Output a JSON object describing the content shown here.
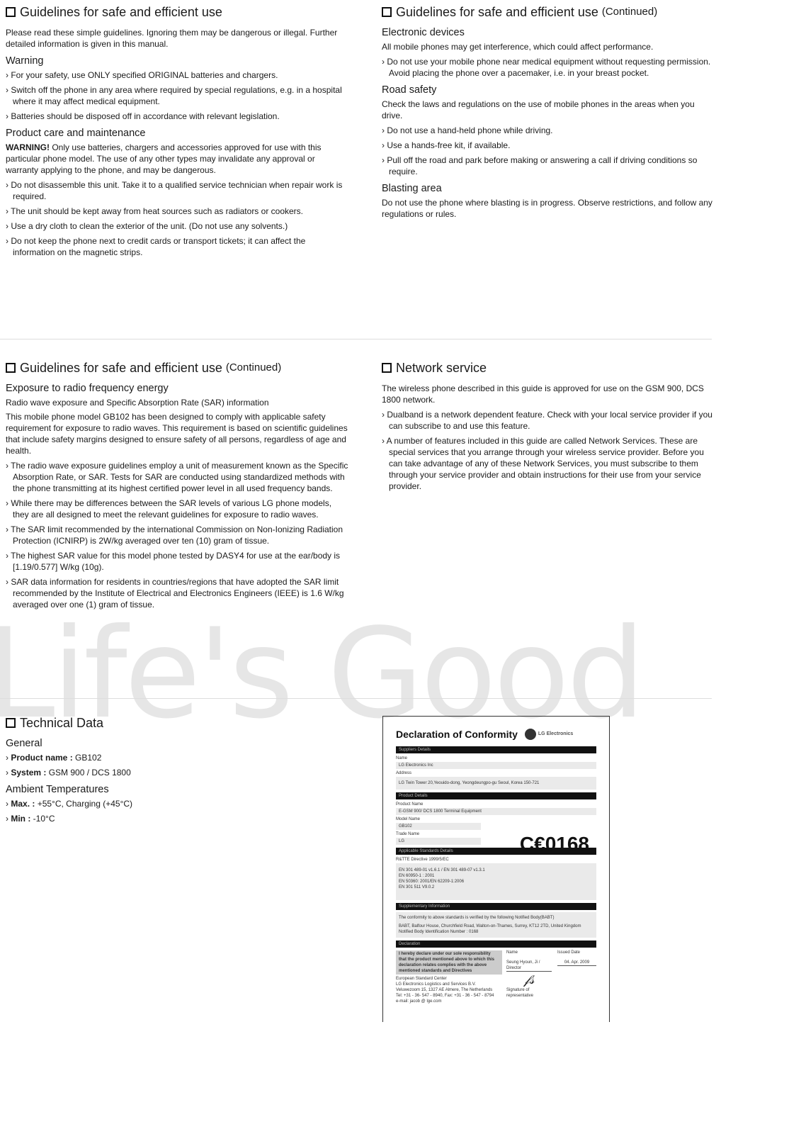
{
  "watermark": "Life's Good",
  "tl": {
    "title": "Guidelines for safe and efficient use",
    "intro": "Please read these simple guidelines. Ignoring them may be dangerous or illegal. Further detailed information is given in this manual.",
    "warning": {
      "heading": "Warning",
      "items": [
        "For your safety, use ONLY specified ORIGINAL batteries and chargers.",
        "Switch off the phone in any area where required by special regulations, e.g. in a hospital where it may affect medical equipment.",
        "Batteries should be disposed off in accordance with relevant legislation."
      ]
    },
    "care": {
      "heading": "Product care and maintenance",
      "warning_label": "WARNING!",
      "text": " Only use batteries, chargers and accessories approved for use with this particular phone model. The use of any other types may invalidate any approval or warranty applying to the phone, and may be dangerous.",
      "items": [
        "Do not disassemble this unit. Take it to a qualified service technician when repair work is required.",
        "The unit should be kept away from heat sources such as radiators or cookers.",
        "Use a dry cloth to clean the exterior of the unit. (Do not use any solvents.)",
        "Do not keep the phone next to credit cards or transport tickets; it can affect the information on the magnetic strips."
      ]
    }
  },
  "tr": {
    "title": "Guidelines for safe and efficient use",
    "cont": "(Continued)",
    "electronic": {
      "heading": "Electronic devices",
      "text": "All mobile phones may get interference, which could affect performance.",
      "items": [
        "Do not use your mobile phone near medical equipment without requesting permission. Avoid placing the phone over a pacemaker, i.e. in your breast pocket."
      ]
    },
    "road": {
      "heading": "Road safety",
      "text": "Check the laws and regulations on the use of mobile phones in the areas when you drive.",
      "items": [
        "Do not use a hand-held phone while driving.",
        "Use a hands-free kit, if available.",
        "Pull off the road and park before making or answering a call if driving conditions so require."
      ]
    },
    "blasting": {
      "heading": "Blasting area",
      "text": "Do not use the phone where blasting is in progress. Observe restrictions, and follow any regulations or rules."
    }
  },
  "ml": {
    "title": "Guidelines for safe and efficient use",
    "cont": "(Continued)",
    "heading": "Exposure to radio frequency energy",
    "sub": "Radio wave exposure and Specific Absorption Rate (SAR) information",
    "text": "This mobile phone model GB102 has been designed to comply with applicable safety requirement for exposure to radio waves. This requirement is based on scientific guidelines that include safety margins designed to ensure safety of all persons, regardless of age and health.",
    "items": [
      "The radio wave exposure guidelines employ a unit of measurement known as the Specific Absorption Rate, or SAR. Tests for SAR are conducted using standardized methods with the phone transmitting at its highest certified power level in all used frequency bands.",
      "While there may be differences between the SAR levels of various LG phone models, they are all designed to meet the relevant guidelines for exposure to radio waves.",
      "The SAR limit recommended by the international Commission on Non-Ionizing Radiation Protection (ICNIRP) is 2W/kg averaged over ten (10) gram of tissue.",
      "The highest SAR value for this model phone tested by DASY4 for use at the ear/body is [1.19/0.577] W/kg (10g).",
      "SAR data information for residents in countries/regions that have adopted the SAR limit recommended by the Institute of Electrical and Electronics Engineers (IEEE) is 1.6 W/kg averaged over one (1) gram of tissue."
    ]
  },
  "mr": {
    "title": "Network service",
    "text": "The wireless phone described in this guide is approved for use on the GSM 900, DCS 1800 network.",
    "items": [
      "Dualband is a network dependent feature. Check with your local service provider if you can subscribe to and use this feature.",
      "A number of features included in this guide are called Network Services. These are special services that you arrange through your wireless service provider. Before you can take advantage of any of these Network Services, you must subscribe to them through your service provider and obtain instructions for their use from your service provider."
    ]
  },
  "bl": {
    "title": "Technical Data",
    "general": "General",
    "pn_label": "Product name :",
    "pn": " GB102",
    "sys_label": "System :",
    "sys": " GSM 900 / DCS 1800",
    "ambient": "Ambient Temperatures",
    "max_label": "Max. :",
    "max": " +55°C, Charging (+45°C)",
    "min_label": "Min :",
    "min": " -10°C"
  },
  "doc": {
    "title": "Declaration of Conformity",
    "logo": "LG Electronics",
    "suppliers": "Suppliers Details",
    "name_l": "Name",
    "name": "LG Electronics Inc",
    "addr_l": "Address",
    "addr": "LG Twin Tower 20,Yeouido-dong, Yeongdeungpo-gu Seoul, Korea 150-721",
    "product": "Product Details",
    "pname_l": "Product Name",
    "pname": "E-GSM 900/ DCS 1800 Terminal Equipment",
    "model_l": "Model Name",
    "model": "GB102",
    "trade_l": "Trade Name",
    "trade": "LG",
    "ce": "C€0168",
    "standards": "Applicable Standards Details",
    "directive": "R&TTE Directive 1999/5/EC",
    "std": [
      "EN 301 489-01 v1.6.1 / EN 301 489-07 v1.3.1",
      "EN 60950-1 : 2001",
      "EN 50360: 2001/EN 62209-1:2006",
      "EN 301 511 V9.0.2"
    ],
    "supp": "Supplementary Information",
    "supp1": "The conformity to above standards is verified by the following Notified Body(BABT)",
    "supp2": "BABT, Balfour House, Churchfield Road, Walton-on-Thames, Surrey, KT12 2TD, United Kingdom",
    "supp3": "Notified Body Identification Number : 0168",
    "decl": "Declaration",
    "decl_text": "I hereby declare under our sole responsibility that the product mentioned above to which this declaration relates complies with the above mentioned standards and Directives",
    "name2_l": "Name",
    "name2": "Seung Hyoun, Ji / Director",
    "date_l": "Issued Date",
    "date": "04. Apr. 2009",
    "esc": [
      "European Standard Center",
      "LG Electronics Logistics and Services B.V.",
      "Veluwezoom 15, 1327 AE Almere, The Netherlands",
      "Tel: +31 - 36- 547 - 8940, Fax: +31 - 36 - 547 - 8794",
      "e-mail: jacob @ lge.com"
    ],
    "sig": "Signature of representative"
  }
}
